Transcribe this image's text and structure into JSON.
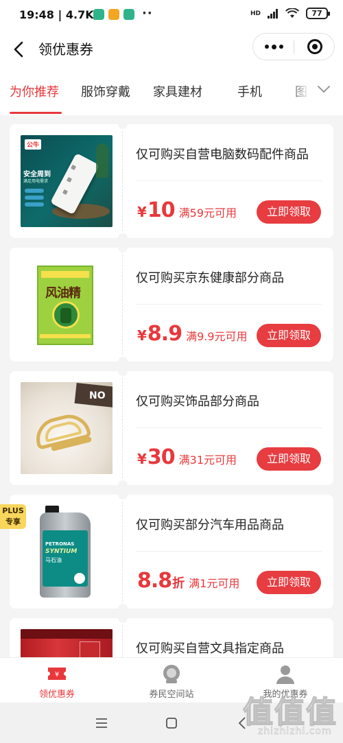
{
  "status_bar": {
    "time": "19:48",
    "speed": "4.7K/s",
    "dots": "··",
    "signal": "HD",
    "battery": "77"
  },
  "header": {
    "title": "领优惠券"
  },
  "tabs": [
    {
      "label": "为你推荐",
      "active": true
    },
    {
      "label": "服饰穿戴",
      "active": false
    },
    {
      "label": "家具建材",
      "active": false
    },
    {
      "label": "手机",
      "active": false
    },
    {
      "label": "图",
      "active": false
    }
  ],
  "coupons": [
    {
      "title": "仅可购买自营电脑数码配件商品",
      "currency": "¥",
      "amount": "10",
      "unit": "",
      "condition": "满59元可用",
      "button": "立即领取",
      "product": "power-strip",
      "product_text": {
        "brand": "公牛",
        "line1": "安全周到",
        "line2": "满足用电需求"
      }
    },
    {
      "title": "仅可购买京东健康部分商品",
      "currency": "¥",
      "amount": "8.9",
      "unit": "",
      "condition": "满9.9元可用",
      "button": "立即领取",
      "product": "medicated-oil",
      "product_text": {
        "name": "风油精"
      }
    },
    {
      "title": "仅可购买饰品部分商品",
      "currency": "¥",
      "amount": "30",
      "unit": "",
      "condition": "满31元可用",
      "button": "立即领取",
      "product": "hair-clip",
      "product_text": {
        "sign": "NO"
      }
    },
    {
      "title": "仅可购买部分汽车用品商品",
      "currency": "",
      "amount": "8.8",
      "unit": "折",
      "condition": "满1元可用",
      "button": "立即领取",
      "product": "motor-oil",
      "plus_badge": {
        "line1": "PLUS",
        "line2": "专享"
      },
      "product_text": {
        "brand": "PETRONAS",
        "model": "SYNTIUM",
        "cn": "马石油"
      }
    },
    {
      "title": "仅可购买自营文具指定商品",
      "currency": "",
      "amount": "",
      "unit": "",
      "condition": "",
      "button": "",
      "product": "stationery"
    }
  ],
  "bottom_nav": [
    {
      "label": "领优惠券",
      "icon": "coupon-icon",
      "active": true
    },
    {
      "label": "券民空间站",
      "icon": "astronaut-icon",
      "active": false
    },
    {
      "label": "我的优惠券",
      "icon": "user-icon",
      "active": false
    }
  ],
  "watermark": {
    "main": "值值值",
    "sub": "zhizhizhi.com"
  },
  "colors": {
    "accent": "#e8383c",
    "button": "#e73c40",
    "plus": "#f9d65c",
    "background": "#f4f4f4"
  }
}
